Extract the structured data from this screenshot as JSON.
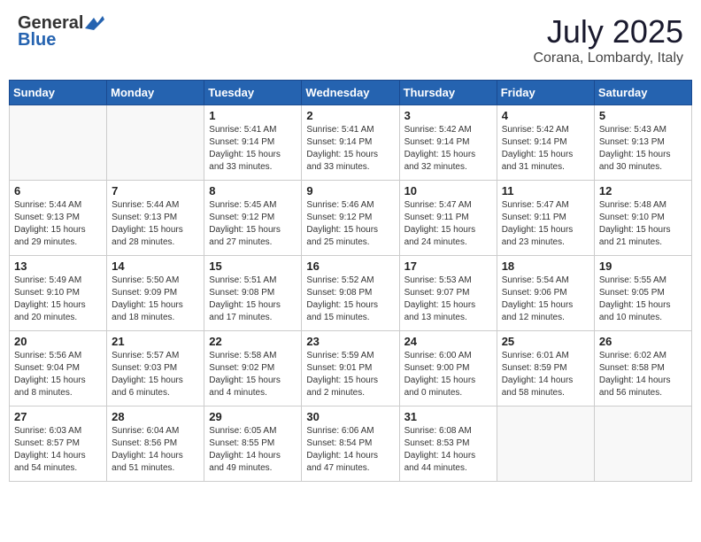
{
  "header": {
    "logo_general": "General",
    "logo_blue": "Blue",
    "month": "July 2025",
    "location": "Corana, Lombardy, Italy"
  },
  "days_of_week": [
    "Sunday",
    "Monday",
    "Tuesday",
    "Wednesday",
    "Thursday",
    "Friday",
    "Saturday"
  ],
  "weeks": [
    [
      {
        "day": "",
        "detail": ""
      },
      {
        "day": "",
        "detail": ""
      },
      {
        "day": "1",
        "detail": "Sunrise: 5:41 AM\nSunset: 9:14 PM\nDaylight: 15 hours\nand 33 minutes."
      },
      {
        "day": "2",
        "detail": "Sunrise: 5:41 AM\nSunset: 9:14 PM\nDaylight: 15 hours\nand 33 minutes."
      },
      {
        "day": "3",
        "detail": "Sunrise: 5:42 AM\nSunset: 9:14 PM\nDaylight: 15 hours\nand 32 minutes."
      },
      {
        "day": "4",
        "detail": "Sunrise: 5:42 AM\nSunset: 9:14 PM\nDaylight: 15 hours\nand 31 minutes."
      },
      {
        "day": "5",
        "detail": "Sunrise: 5:43 AM\nSunset: 9:13 PM\nDaylight: 15 hours\nand 30 minutes."
      }
    ],
    [
      {
        "day": "6",
        "detail": "Sunrise: 5:44 AM\nSunset: 9:13 PM\nDaylight: 15 hours\nand 29 minutes."
      },
      {
        "day": "7",
        "detail": "Sunrise: 5:44 AM\nSunset: 9:13 PM\nDaylight: 15 hours\nand 28 minutes."
      },
      {
        "day": "8",
        "detail": "Sunrise: 5:45 AM\nSunset: 9:12 PM\nDaylight: 15 hours\nand 27 minutes."
      },
      {
        "day": "9",
        "detail": "Sunrise: 5:46 AM\nSunset: 9:12 PM\nDaylight: 15 hours\nand 25 minutes."
      },
      {
        "day": "10",
        "detail": "Sunrise: 5:47 AM\nSunset: 9:11 PM\nDaylight: 15 hours\nand 24 minutes."
      },
      {
        "day": "11",
        "detail": "Sunrise: 5:47 AM\nSunset: 9:11 PM\nDaylight: 15 hours\nand 23 minutes."
      },
      {
        "day": "12",
        "detail": "Sunrise: 5:48 AM\nSunset: 9:10 PM\nDaylight: 15 hours\nand 21 minutes."
      }
    ],
    [
      {
        "day": "13",
        "detail": "Sunrise: 5:49 AM\nSunset: 9:10 PM\nDaylight: 15 hours\nand 20 minutes."
      },
      {
        "day": "14",
        "detail": "Sunrise: 5:50 AM\nSunset: 9:09 PM\nDaylight: 15 hours\nand 18 minutes."
      },
      {
        "day": "15",
        "detail": "Sunrise: 5:51 AM\nSunset: 9:08 PM\nDaylight: 15 hours\nand 17 minutes."
      },
      {
        "day": "16",
        "detail": "Sunrise: 5:52 AM\nSunset: 9:08 PM\nDaylight: 15 hours\nand 15 minutes."
      },
      {
        "day": "17",
        "detail": "Sunrise: 5:53 AM\nSunset: 9:07 PM\nDaylight: 15 hours\nand 13 minutes."
      },
      {
        "day": "18",
        "detail": "Sunrise: 5:54 AM\nSunset: 9:06 PM\nDaylight: 15 hours\nand 12 minutes."
      },
      {
        "day": "19",
        "detail": "Sunrise: 5:55 AM\nSunset: 9:05 PM\nDaylight: 15 hours\nand 10 minutes."
      }
    ],
    [
      {
        "day": "20",
        "detail": "Sunrise: 5:56 AM\nSunset: 9:04 PM\nDaylight: 15 hours\nand 8 minutes."
      },
      {
        "day": "21",
        "detail": "Sunrise: 5:57 AM\nSunset: 9:03 PM\nDaylight: 15 hours\nand 6 minutes."
      },
      {
        "day": "22",
        "detail": "Sunrise: 5:58 AM\nSunset: 9:02 PM\nDaylight: 15 hours\nand 4 minutes."
      },
      {
        "day": "23",
        "detail": "Sunrise: 5:59 AM\nSunset: 9:01 PM\nDaylight: 15 hours\nand 2 minutes."
      },
      {
        "day": "24",
        "detail": "Sunrise: 6:00 AM\nSunset: 9:00 PM\nDaylight: 15 hours\nand 0 minutes."
      },
      {
        "day": "25",
        "detail": "Sunrise: 6:01 AM\nSunset: 8:59 PM\nDaylight: 14 hours\nand 58 minutes."
      },
      {
        "day": "26",
        "detail": "Sunrise: 6:02 AM\nSunset: 8:58 PM\nDaylight: 14 hours\nand 56 minutes."
      }
    ],
    [
      {
        "day": "27",
        "detail": "Sunrise: 6:03 AM\nSunset: 8:57 PM\nDaylight: 14 hours\nand 54 minutes."
      },
      {
        "day": "28",
        "detail": "Sunrise: 6:04 AM\nSunset: 8:56 PM\nDaylight: 14 hours\nand 51 minutes."
      },
      {
        "day": "29",
        "detail": "Sunrise: 6:05 AM\nSunset: 8:55 PM\nDaylight: 14 hours\nand 49 minutes."
      },
      {
        "day": "30",
        "detail": "Sunrise: 6:06 AM\nSunset: 8:54 PM\nDaylight: 14 hours\nand 47 minutes."
      },
      {
        "day": "31",
        "detail": "Sunrise: 6:08 AM\nSunset: 8:53 PM\nDaylight: 14 hours\nand 44 minutes."
      },
      {
        "day": "",
        "detail": ""
      },
      {
        "day": "",
        "detail": ""
      }
    ]
  ]
}
